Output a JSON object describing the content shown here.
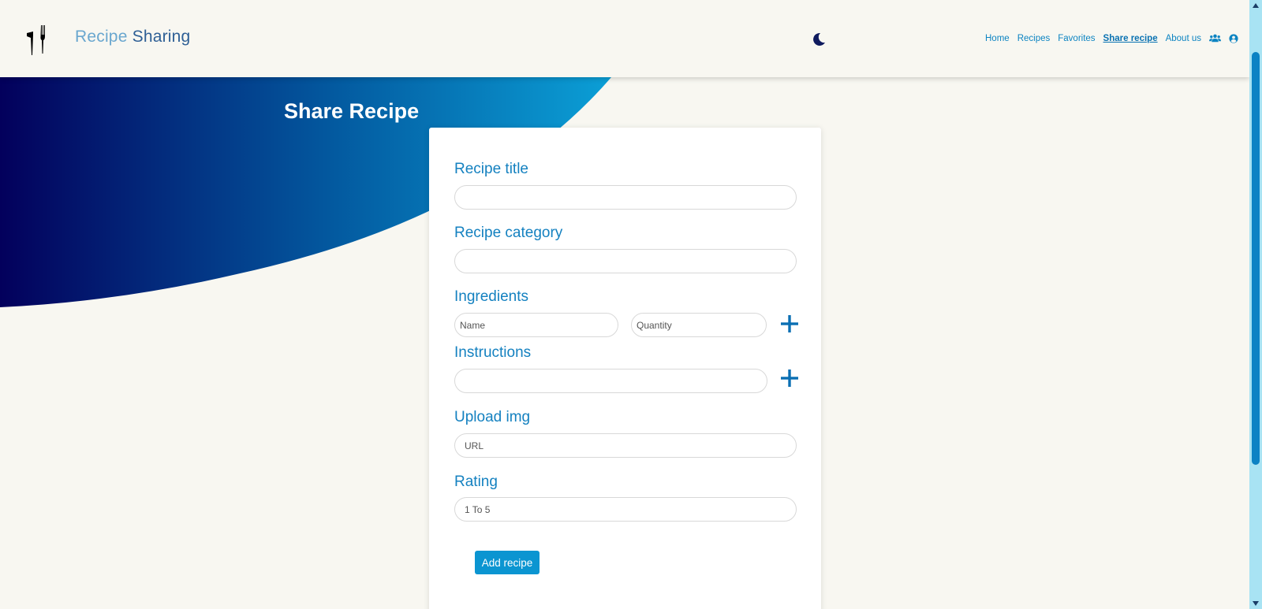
{
  "header": {
    "brand_part1": "Recipe",
    "brand_part2": "Sharing",
    "nav": [
      {
        "label": "Home",
        "active": false
      },
      {
        "label": "Recipes",
        "active": false
      },
      {
        "label": "Favorites",
        "active": false
      },
      {
        "label": "Share recipe",
        "active": true
      },
      {
        "label": "About us",
        "active": false
      }
    ],
    "icons": [
      "fork-knife-logo-icon",
      "moon-icon",
      "users-icon",
      "user-circle-icon"
    ]
  },
  "hero": {
    "title": "Share Recipe"
  },
  "form": {
    "title_label": "Recipe title",
    "title_value": "",
    "category_label": "Recipe category",
    "category_value": "",
    "ingredients_label": "Ingredients",
    "ingredient_name_placeholder": "Name",
    "ingredient_quantity_placeholder": "Quantity",
    "instructions_label": "Instructions",
    "instructions_value": "",
    "upload_label": "Upload img",
    "upload_placeholder": "URL",
    "rating_label": "Rating",
    "rating_placeholder": "1 To 5",
    "submit_label": "Add recipe"
  },
  "colors": {
    "accent": "#1481c0",
    "button": "#0b95d1",
    "hero_dark": "#03005c",
    "hero_light": "#0b95d1",
    "background": "#f8f7f1"
  }
}
